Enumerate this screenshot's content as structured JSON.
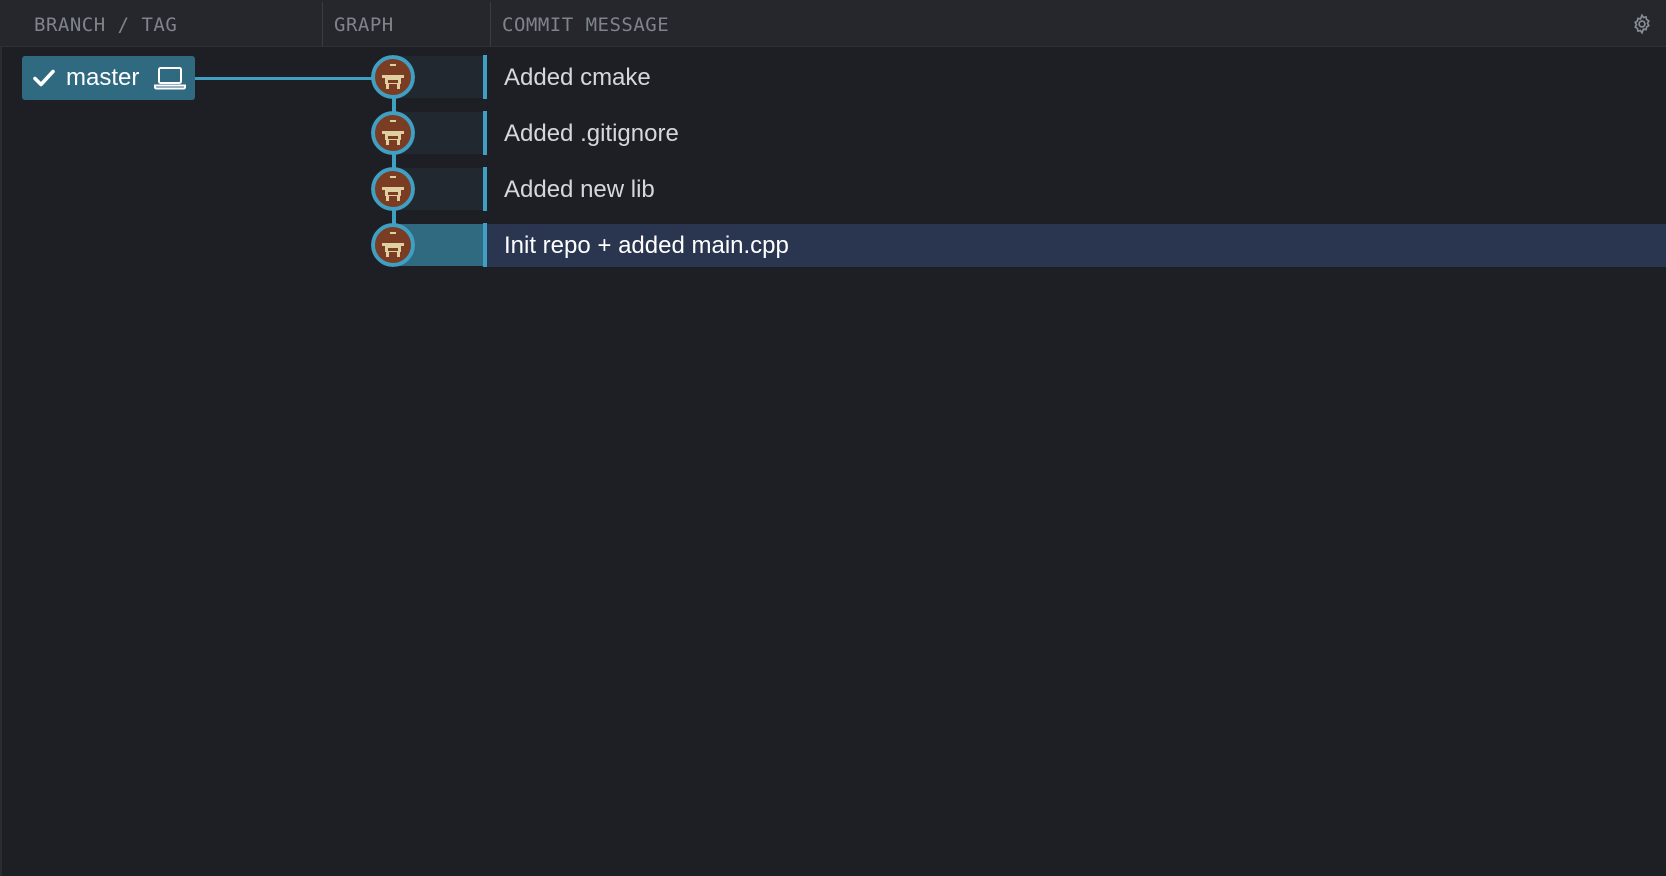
{
  "header": {
    "columns": {
      "branch_tag": "BRANCH / TAG",
      "graph": "GRAPH",
      "commit_message": "COMMIT MESSAGE"
    },
    "settings_icon": "gear-icon"
  },
  "branch": {
    "name": "master",
    "is_checked_out": true,
    "check_icon": "check-icon",
    "local_icon": "laptop-icon",
    "color": "#2f6a80"
  },
  "graph": {
    "line_color": "#3fa0c4",
    "avatar_icon": "pixel-avatar-icon"
  },
  "commits": [
    {
      "message": "Added cmake",
      "selected": false
    },
    {
      "message": "Added .gitignore",
      "selected": false
    },
    {
      "message": "Added new lib",
      "selected": false
    },
    {
      "message": "Init repo + added main.cpp",
      "selected": true
    }
  ],
  "colors": {
    "background": "#1d1f24",
    "header_background": "#25272d",
    "selected_row": "#2a3550",
    "accent": "#3fa0c4"
  }
}
